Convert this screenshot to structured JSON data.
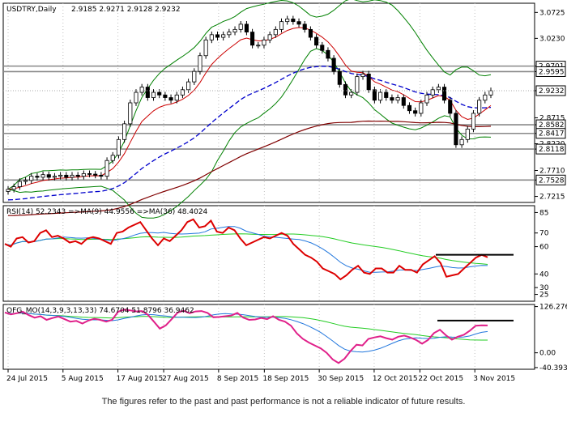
{
  "chart_data": [
    {
      "type": "candlestick",
      "title": "USDTRY,Daily",
      "ohlc_label": "2.9185 2.9271 2.9128 2.9232",
      "last_price_label": "2.9232",
      "last_price": 2.9232,
      "ylim": [
        2.71,
        3.09
      ],
      "y_ticks": [
        "3.0725",
        "3.0230",
        "2.9701",
        "2.9595",
        "2.9232",
        "2.8715",
        "2.8582",
        "2.8417",
        "2.8220",
        "2.8118",
        "2.7710",
        "2.7528",
        "2.7215"
      ],
      "levels": [
        {
          "label": "2.9701",
          "value": 2.9701,
          "color": "#888888"
        },
        {
          "label": "2.9595",
          "value": 2.9595,
          "color": "#888888"
        },
        {
          "label": "2.8582",
          "value": 2.8582,
          "color": "#888888"
        },
        {
          "label": "2.8417",
          "value": 2.8417,
          "color": "#888888"
        },
        {
          "label": "2.8118",
          "value": 2.8118,
          "color": "#888888"
        },
        {
          "label": "2.7528",
          "value": 2.7528,
          "color": "#888888"
        }
      ],
      "x_dates": [
        "24 Jul 2015",
        "5 Aug 2015",
        "17 Aug 2015",
        "27 Aug 2015",
        "8 Sep 2015",
        "18 Sep 2015",
        "30 Sep 2015",
        "12 Oct 2015",
        "22 Oct 2015",
        "3 Nov 2015",
        "15 Nov 2015"
      ],
      "x_ticks": [
        "24 Jul 2015",
        "5 Aug 2015",
        "17 Aug 2015",
        "27 Aug 2015",
        "8 Sep 2015",
        "18 Sep 2015",
        "30 Sep 2015",
        "12 Oct 2015",
        "22 Oct 2015",
        "3 Nov 2015"
      ],
      "close_series": [
        2.735,
        2.74,
        2.75,
        2.752,
        2.76,
        2.758,
        2.763,
        2.758,
        2.76,
        2.762,
        2.758,
        2.762,
        2.76,
        2.765,
        2.764,
        2.762,
        2.76,
        2.79,
        2.8,
        2.83,
        2.86,
        2.9,
        2.92,
        2.93,
        2.91,
        2.92,
        2.915,
        2.91,
        2.905,
        2.915,
        2.925,
        2.94,
        2.96,
        2.99,
        3.02,
        3.03,
        3.025,
        3.03,
        3.035,
        3.04,
        3.05,
        3.035,
        3.01,
        3.01,
        3.02,
        3.03,
        3.04,
        3.055,
        3.06,
        3.055,
        3.05,
        3.04,
        3.025,
        3.01,
        3.0,
        2.985,
        2.96,
        2.935,
        2.915,
        2.92,
        2.95,
        2.955,
        2.925,
        2.905,
        2.92,
        2.91,
        2.905,
        2.91,
        2.895,
        2.885,
        2.88,
        2.9,
        2.915,
        2.925,
        2.93,
        2.905,
        2.88,
        2.82,
        2.83,
        2.85,
        2.88,
        2.905,
        2.915,
        2.9232
      ],
      "series": [
        {
          "name": "SMA short",
          "color": "#cc0000"
        },
        {
          "name": "SMA long",
          "color": "#800000"
        },
        {
          "name": "SMA mid",
          "color": "#0000cc"
        },
        {
          "name": "Bollinger",
          "color": "#008000"
        }
      ]
    },
    {
      "type": "line",
      "label": "RSI(14) 52.2343  =>MA(9) 44.9556  =>MA(36) 48.4024",
      "ylim": [
        20,
        90
      ],
      "y_ticks": [
        "85",
        "70",
        "60",
        "40",
        "30",
        "25"
      ],
      "values": [
        62,
        60,
        66,
        67,
        63,
        64,
        70,
        72,
        67,
        68,
        66,
        63,
        64,
        62,
        66,
        67,
        66,
        64,
        62,
        70,
        71,
        74,
        76,
        78,
        72,
        66,
        61,
        66,
        64,
        68,
        72,
        78,
        80,
        74,
        75,
        79,
        71,
        70,
        74,
        72,
        66,
        61,
        63,
        65,
        67,
        66,
        68,
        70,
        68,
        62,
        58,
        54,
        52,
        49,
        44,
        42,
        40,
        36,
        39,
        43,
        46,
        41,
        40,
        44,
        44,
        41,
        41,
        46,
        43,
        43,
        41,
        47,
        50,
        53,
        48,
        38,
        39,
        40,
        44,
        48,
        52,
        54,
        52.2343
      ],
      "series": [
        {
          "name": "RSI",
          "color": "#dd0000"
        },
        {
          "name": "MA(9)",
          "color": "#2277dd"
        },
        {
          "name": "MA(36)",
          "color": "#22cc22"
        }
      ],
      "annotation": {
        "type": "horizontal-line",
        "color": "#000000"
      }
    },
    {
      "type": "line",
      "label": "OFG_MO(14,3,9,3,13,33) 74.6704  51.8796  36.9462",
      "ylim": [
        -45,
        132
      ],
      "y_ticks": [
        "126.2762",
        "0.00",
        "-40.3933"
      ],
      "values": [
        110,
        105,
        108,
        112,
        103,
        96,
        100,
        90,
        95,
        99,
        92,
        85,
        87,
        80,
        88,
        93,
        90,
        85,
        90,
        112,
        118,
        116,
        113,
        114,
        104,
        85,
        66,
        75,
        92,
        110,
        115,
        108,
        113,
        114,
        109,
        97,
        98,
        100,
        102,
        109,
        96,
        90,
        91,
        95,
        92,
        100,
        90,
        85,
        74,
        53,
        38,
        28,
        20,
        12,
        0,
        -18,
        -28,
        -16,
        5,
        22,
        20,
        38,
        42,
        45,
        40,
        36,
        44,
        47,
        42,
        35,
        25,
        35,
        54,
        63,
        48,
        36,
        44,
        49,
        60,
        74,
        75,
        74.6704
      ],
      "series": [
        {
          "name": "OFG_MO",
          "color": "#e0218a"
        },
        {
          "name": "signal",
          "color": "#2277dd"
        },
        {
          "name": "trend",
          "color": "#22cc22"
        }
      ],
      "annotation": {
        "type": "horizontal-line",
        "color": "#000000"
      }
    }
  ],
  "disclaimer": "The figures refer to the past and past performance is not a reliable indicator of future results.",
  "colors": {
    "background": "#ffffff",
    "grid": "#c0c0c0",
    "last_price_badge": "#ffffff"
  }
}
